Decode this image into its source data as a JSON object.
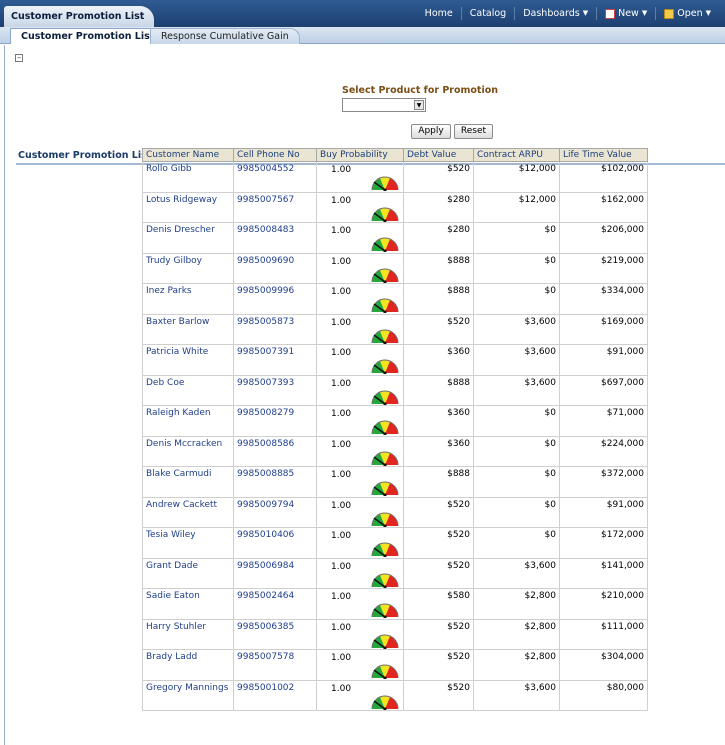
{
  "header": {
    "dashboard_title": "Customer Promotion List",
    "nav": {
      "home": "Home",
      "catalog": "Catalog",
      "dashboards": "Dashboards",
      "new": "New",
      "open": "Open"
    }
  },
  "tabs": [
    {
      "label": "Customer Promotion List",
      "active": true
    },
    {
      "label": "Response Cumulative Gain",
      "active": false
    }
  ],
  "prompt": {
    "label": "Select Product for Promotion",
    "selected_value": "",
    "apply_label": "Apply",
    "reset_label": "Reset"
  },
  "section": {
    "title": "Customer Promotion List"
  },
  "table": {
    "columns": [
      "Customer Name",
      "Cell Phone No",
      "Buy Probability",
      "Debt Value",
      "Contract ARPU",
      "Life Time Value"
    ],
    "rows": [
      {
        "name": "Rollo Gibb",
        "phone": "9985004552",
        "prob": "1.00",
        "debt": "$520",
        "arpu": "$12,000",
        "ltv": "$102,000"
      },
      {
        "name": "Lotus Ridgeway",
        "phone": "9985007567",
        "prob": "1.00",
        "debt": "$280",
        "arpu": "$12,000",
        "ltv": "$162,000"
      },
      {
        "name": "Denis Drescher",
        "phone": "9985008483",
        "prob": "1.00",
        "debt": "$280",
        "arpu": "$0",
        "ltv": "$206,000"
      },
      {
        "name": "Trudy Gilboy",
        "phone": "9985009690",
        "prob": "1.00",
        "debt": "$888",
        "arpu": "$0",
        "ltv": "$219,000"
      },
      {
        "name": "Inez Parks",
        "phone": "9985009996",
        "prob": "1.00",
        "debt": "$888",
        "arpu": "$0",
        "ltv": "$334,000"
      },
      {
        "name": "Baxter Barlow",
        "phone": "9985005873",
        "prob": "1.00",
        "debt": "$520",
        "arpu": "$3,600",
        "ltv": "$169,000"
      },
      {
        "name": "Patricia White",
        "phone": "9985007391",
        "prob": "1.00",
        "debt": "$360",
        "arpu": "$3,600",
        "ltv": "$91,000"
      },
      {
        "name": "Deb Coe",
        "phone": "9985007393",
        "prob": "1.00",
        "debt": "$888",
        "arpu": "$3,600",
        "ltv": "$697,000"
      },
      {
        "name": "Raleigh Kaden",
        "phone": "9985008279",
        "prob": "1.00",
        "debt": "$360",
        "arpu": "$0",
        "ltv": "$71,000"
      },
      {
        "name": "Denis Mccracken",
        "phone": "9985008586",
        "prob": "1.00",
        "debt": "$360",
        "arpu": "$0",
        "ltv": "$224,000"
      },
      {
        "name": "Blake Carmudi",
        "phone": "9985008885",
        "prob": "1.00",
        "debt": "$888",
        "arpu": "$0",
        "ltv": "$372,000"
      },
      {
        "name": "Andrew Cackett",
        "phone": "9985009794",
        "prob": "1.00",
        "debt": "$520",
        "arpu": "$0",
        "ltv": "$91,000"
      },
      {
        "name": "Tesia Wiley",
        "phone": "9985010406",
        "prob": "1.00",
        "debt": "$520",
        "arpu": "$0",
        "ltv": "$172,000"
      },
      {
        "name": "Grant Dade",
        "phone": "9985006984",
        "prob": "1.00",
        "debt": "$520",
        "arpu": "$3,600",
        "ltv": "$141,000"
      },
      {
        "name": "Sadie Eaton",
        "phone": "9985002464",
        "prob": "1.00",
        "debt": "$580",
        "arpu": "$2,800",
        "ltv": "$210,000"
      },
      {
        "name": "Harry Stuhler",
        "phone": "9985006385",
        "prob": "1.00",
        "debt": "$520",
        "arpu": "$2,800",
        "ltv": "$111,000"
      },
      {
        "name": "Brady Ladd",
        "phone": "9985007578",
        "prob": "1.00",
        "debt": "$520",
        "arpu": "$2,800",
        "ltv": "$304,000"
      },
      {
        "name": "Gregory Mannings",
        "phone": "9985001002",
        "prob": "1.00",
        "debt": "$520",
        "arpu": "$3,600",
        "ltv": "$80,000"
      }
    ]
  },
  "icons": {
    "gauge": "gauge-icon",
    "collapse": "collapse-icon",
    "dropdown": "chevron-down-icon",
    "new": "new-document-icon",
    "open": "folder-icon"
  },
  "colors": {
    "header_bg": "#1d3f6f",
    "link_text": "#1f3f8a",
    "prompt_label": "#7a4e14",
    "table_header_bg": "#eae5d3"
  }
}
